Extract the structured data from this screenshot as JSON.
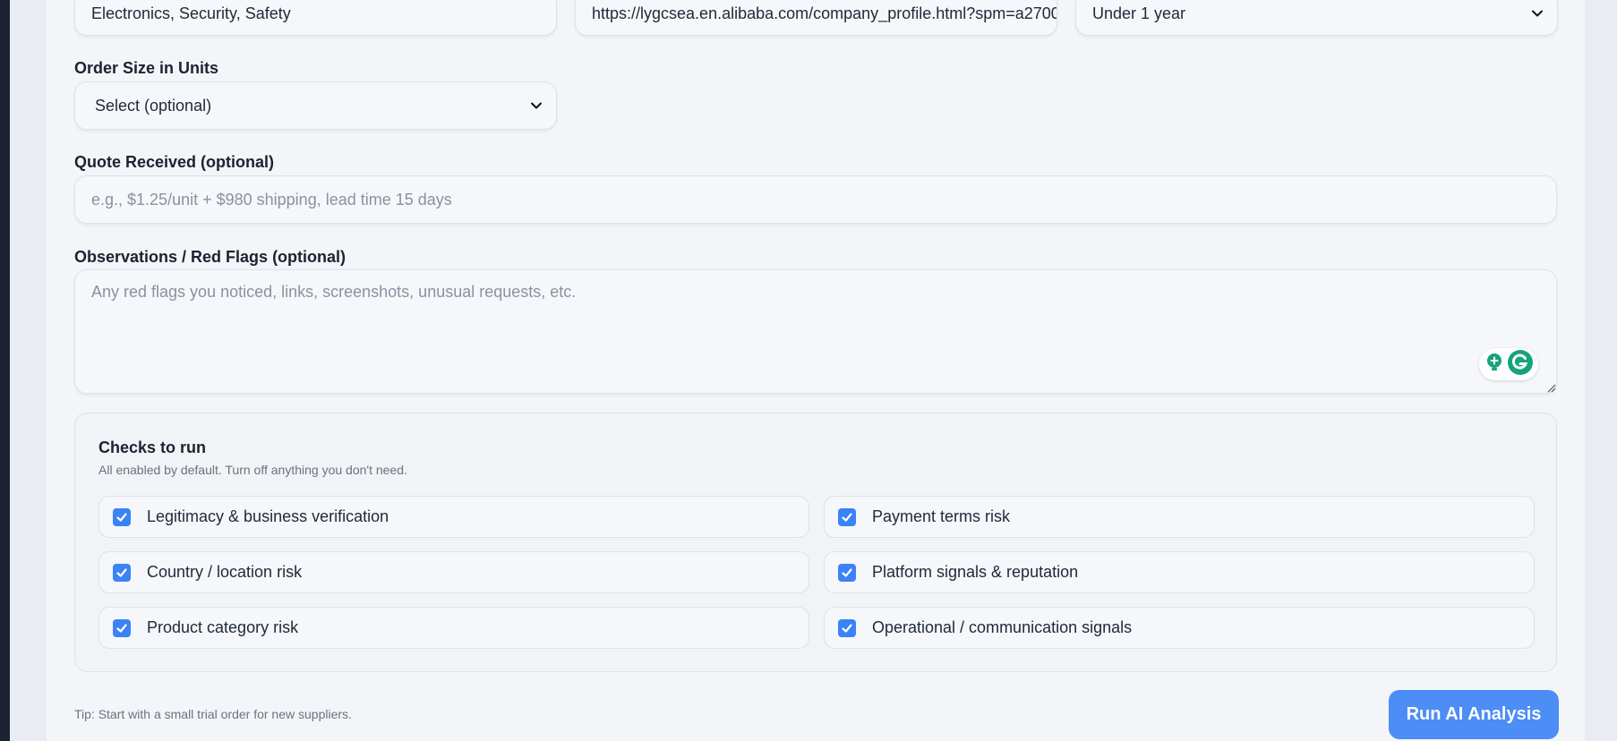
{
  "top_row": {
    "industry_value": "Electronics, Security, Safety",
    "url_value": "https://lygcsea.en.alibaba.com/company_profile.html?spm=a2700",
    "years_value": "Under 1 year"
  },
  "order_size": {
    "label": "Order Size in Units",
    "selected": "Select (optional)"
  },
  "quote": {
    "label": "Quote Received (optional)",
    "placeholder": "e.g., $1.25/unit + $980 shipping, lead time 15 days"
  },
  "observations": {
    "label": "Observations / Red Flags (optional)",
    "placeholder": "Any red flags you noticed, links, screenshots, unusual requests, etc."
  },
  "checks": {
    "title": "Checks to run",
    "subtitle": "All enabled by default. Turn off anything you don't need.",
    "items": [
      {
        "label": "Legitimacy & business verification",
        "checked": true
      },
      {
        "label": "Payment terms risk",
        "checked": true
      },
      {
        "label": "Country / location risk",
        "checked": true
      },
      {
        "label": "Platform signals & reputation",
        "checked": true
      },
      {
        "label": "Product category risk",
        "checked": true
      },
      {
        "label": "Operational / communication signals",
        "checked": true
      }
    ]
  },
  "footer": {
    "tip": "Tip: Start with a small trial order for new suppliers.",
    "run_label": "Run AI Analysis"
  },
  "colors": {
    "accent": "#4c8df6",
    "checkbox": "#3b82f6",
    "grammarly_green": "#15a47a"
  }
}
